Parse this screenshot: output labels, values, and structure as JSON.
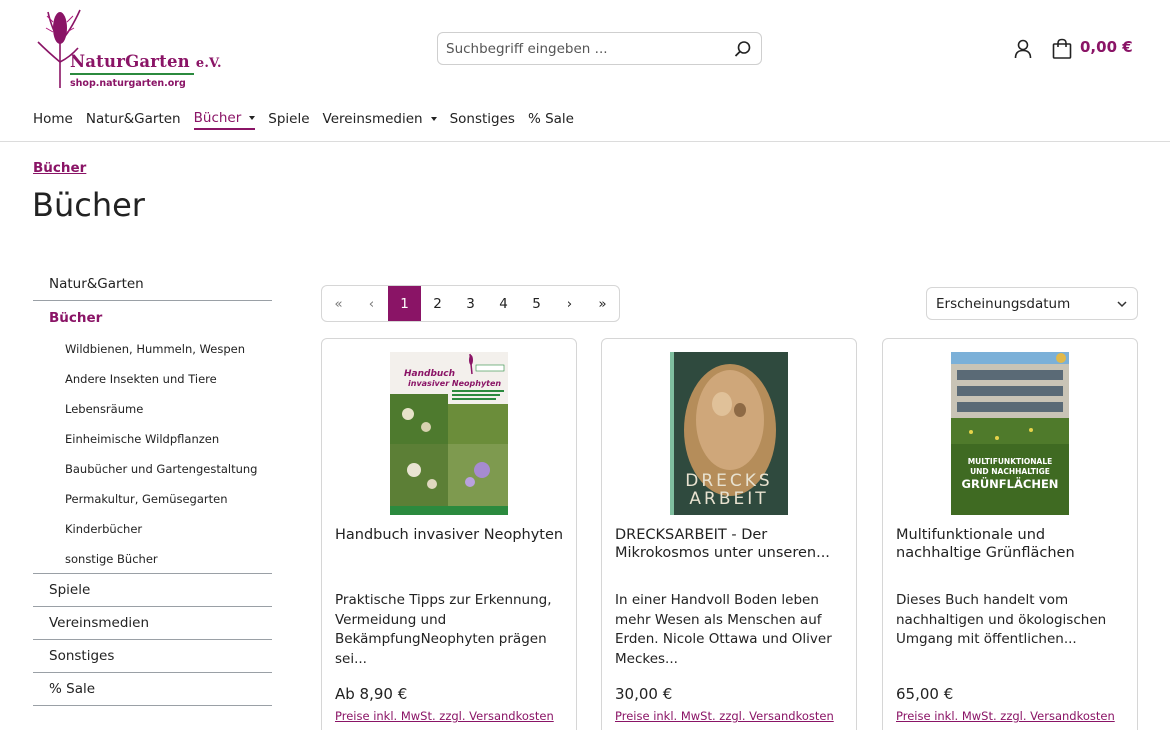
{
  "header": {
    "logo_name": "NaturGarten",
    "logo_suffix": "e.V.",
    "logo_url": "shop.naturgarten.org",
    "search_placeholder": "Suchbegriff eingeben ...",
    "cart_total": "0,00 €"
  },
  "nav": {
    "items": [
      {
        "label": "Home",
        "dropdown": false,
        "active": false
      },
      {
        "label": "Natur&Garten",
        "dropdown": false,
        "active": false
      },
      {
        "label": "Bücher",
        "dropdown": true,
        "active": true
      },
      {
        "label": "Spiele",
        "dropdown": false,
        "active": false
      },
      {
        "label": "Vereinsmedien",
        "dropdown": true,
        "active": false
      },
      {
        "label": "Sonstiges",
        "dropdown": false,
        "active": false
      },
      {
        "label": "% Sale",
        "dropdown": false,
        "active": false
      }
    ]
  },
  "breadcrumb": "Bücher",
  "page_title": "Bücher",
  "sidebar": {
    "top": "Natur&Garten",
    "active": "Bücher",
    "sub": [
      "Wildbienen, Hummeln, Wespen",
      "Andere Insekten und Tiere",
      "Lebensräume",
      "Einheimische Wildpflanzen",
      "Baubücher und Gartengestaltung",
      "Permakultur, Gemüsegarten",
      "Kinderbücher",
      "sonstige Bücher"
    ],
    "bottom": [
      "Spiele",
      "Vereinsmedien",
      "Sonstiges",
      "% Sale"
    ]
  },
  "pagination": {
    "first": "«",
    "prev": "‹",
    "pages": [
      "1",
      "2",
      "3",
      "4",
      "5"
    ],
    "current": "1",
    "next": "›",
    "last": "»"
  },
  "sort": {
    "selected": "Erscheinungsdatum"
  },
  "products": [
    {
      "name": "Handbuch invasiver Neophyten",
      "description": "Praktische Tipps zur Erkennung, Vermeidung und BekämpfungNeophyten prägen sei...",
      "price": "Ab 8,90 €",
      "vat_note": "Preise inkl. MwSt. zzgl. Versandkosten",
      "cover_title": "Handbuch invasiver Neophyten",
      "cover_subtitle": "Praktische Tipps zur Erkennung, Vermeidung und Bekämpfung"
    },
    {
      "name": "DRECKSARBEIT - Der Mikrokosmos unter unseren...",
      "description": "In einer Handvoll Boden leben mehr Wesen als Menschen auf Erden. Nicole Ottawa und Oliver Meckes...",
      "price": "30,00 €",
      "vat_note": "Preise inkl. MwSt. zzgl. Versandkosten",
      "cover_line1": "DRECKS",
      "cover_line2": "ARBEIT"
    },
    {
      "name": "Multifunktionale und nachhaltige Grünflächen",
      "description": "Dieses Buch handelt vom nachhaltigen und ökologischen Umgang mit öffentlichen...",
      "price": "65,00 €",
      "vat_note": "Preise inkl. MwSt. zzgl. Versandkosten",
      "cover_line1": "MULTIFUNKTIONALE",
      "cover_line2": "UND NACHHALTIGE",
      "cover_line3": "GRÜNFLÄCHEN"
    }
  ]
}
